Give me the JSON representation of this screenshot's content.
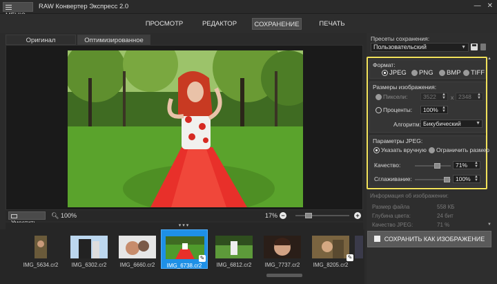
{
  "app": {
    "menu_label": "МЕНЮ",
    "title": "RAW Конвертер Экспресс 2.0"
  },
  "nav": {
    "tabs": [
      "ПРОСМОТР",
      "РЕДАКТОР",
      "СОХРАНЕНИЕ",
      "ПЕЧАТЬ"
    ],
    "active": "СОХРАНЕНИЕ"
  },
  "view_tabs": [
    "Оригинал",
    "Оптимизированное"
  ],
  "zoombar": {
    "fit_label": "Уместить",
    "left_zoom": "100%",
    "zoom_percent": "17%",
    "minus": "−",
    "plus": "+"
  },
  "filmstrip": {
    "items": [
      {
        "name": "IMG_5634.cr2",
        "selected": false,
        "edited": false
      },
      {
        "name": "IMG_6302.cr2",
        "selected": false,
        "edited": false
      },
      {
        "name": "IMG_6660.cr2",
        "selected": false,
        "edited": false
      },
      {
        "name": "IMG_6738.cr2",
        "selected": true,
        "edited": true
      },
      {
        "name": "IMG_6812.cr2",
        "selected": false,
        "edited": false
      },
      {
        "name": "IMG_7737.cr2",
        "selected": false,
        "edited": false
      },
      {
        "name": "IMG_8205.cr2",
        "selected": false,
        "edited": true
      }
    ]
  },
  "panel": {
    "presets_label": "Пресеты сохранения:",
    "preset_value": "Пользовательский",
    "format": {
      "title": "Формат:",
      "options": [
        "JPEG",
        "PNG",
        "BMP",
        "TIFF"
      ],
      "selected": "JPEG"
    },
    "size": {
      "title": "Размеры изображения:",
      "pixels_label": "Пиксели:",
      "width": "3522",
      "x": "x",
      "height": "2348",
      "percent_label": "Проценты:",
      "percent_value": "100%",
      "algorithm_label": "Алгоритм:",
      "algorithm_value": "Бикубический"
    },
    "jpeg": {
      "title": "Параметры JPEG:",
      "manual": "Указать вручную",
      "limit": "Ограничить размер",
      "quality_label": "Качество:",
      "quality_value": "71%",
      "smoothing_label": "Сглаживание:",
      "smoothing_value": "100%"
    },
    "info": {
      "title": "Информация об изображении:",
      "rows": [
        {
          "k": "Размер файла",
          "v": "558 КБ"
        },
        {
          "k": "Глубина цвета:",
          "v": "24 бит"
        },
        {
          "k": "Качество JPEG:",
          "v": "71 %"
        }
      ]
    },
    "save_button": "СОХРАНИТЬ КАК ИЗОБРАЖЕНИЕ"
  },
  "colors": {
    "accent": "#1e90e6",
    "highlight": "#f2e25a",
    "dress": "#e8302a",
    "grass": "#4f9a2c"
  }
}
